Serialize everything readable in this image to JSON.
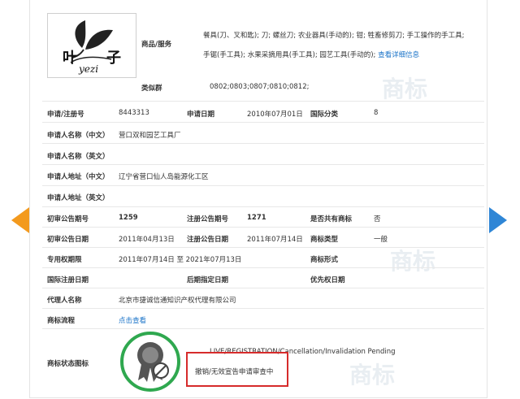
{
  "logo": {
    "text_cn_left": "叶",
    "text_cn_right": "子",
    "text_latin": "yezi"
  },
  "goods": {
    "label": "商品/服务",
    "line1": "餐具(刀、叉和匙); 刀; 螺丝刀; 农业器具(手动的); 钳; 牲畜修剪刀; 手工操作的手工具;",
    "line2": "手锯(手工具); 水果采摘用具(手工具); 园艺工具(手动的);",
    "detail_link": "查看详细信息"
  },
  "similar_group": {
    "label": "类似群",
    "value": "0802;0803;0807;0810;0812;"
  },
  "reg_no": {
    "label": "申请/注册号",
    "value": "8443313"
  },
  "apply_date": {
    "label": "申请日期",
    "value": "2010年07月01日"
  },
  "intl_class": {
    "label": "国际分类",
    "value": "8"
  },
  "applicant_cn": {
    "label": "申请人名称（中文）",
    "value": "营口双和园艺工具厂"
  },
  "applicant_en": {
    "label": "申请人名称（英文）",
    "value": ""
  },
  "address_cn": {
    "label": "申请人地址（中文）",
    "value": "辽宁省营口仙人岛能源化工区"
  },
  "address_en": {
    "label": "申请人地址（英文）",
    "value": ""
  },
  "prelim_no": {
    "label": "初审公告期号",
    "value": "1259"
  },
  "reg_pub_no": {
    "label": "注册公告期号",
    "value": "1271"
  },
  "shared": {
    "label": "是否共有商标",
    "value": "否"
  },
  "prelim_date": {
    "label": "初审公告日期",
    "value": "2011年04月13日"
  },
  "reg_pub_date": {
    "label": "注册公告日期",
    "value": "2011年07月14日"
  },
  "mark_type": {
    "label": "商标类型",
    "value": "一般"
  },
  "exclusive": {
    "label": "专用权期限",
    "value": "2011年07月14日 至 2021年07月13日"
  },
  "mark_form": {
    "label": "商标形式",
    "value": ""
  },
  "intl_reg_date": {
    "label": "国际注册日期",
    "value": ""
  },
  "later_date": {
    "label": "后期指定日期",
    "value": ""
  },
  "priority_date": {
    "label": "优先权日期",
    "value": ""
  },
  "agent": {
    "label": "代理人名称",
    "value": "北京市捷诚信通知识产权代理有限公司"
  },
  "process": {
    "label": "商标流程",
    "link": "点击查看"
  },
  "status": {
    "label": "商标状态图标",
    "en": "LIVE/REGISTRATION/Cancellation/Invalidation Pending",
    "cn": "撤销/无效宣告申请审查中"
  },
  "watermark": "商标",
  "colors": {
    "accent_orange": "#f39a1e",
    "accent_blue": "#2f86d6",
    "status_green": "#2fa84f",
    "highlight_red": "#d62b2b"
  }
}
